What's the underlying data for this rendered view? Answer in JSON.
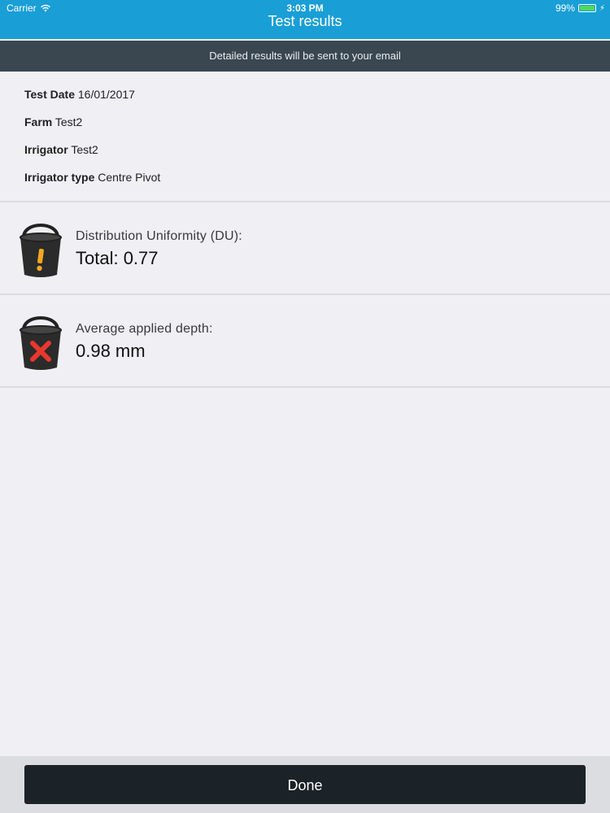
{
  "status_bar": {
    "carrier": "Carrier",
    "time": "3:03 PM",
    "battery_text": "99%",
    "battery_level": 0.99,
    "battery_color": "#4cd964"
  },
  "nav": {
    "title": "Test results",
    "bg_color": "#1a9ed6"
  },
  "banner": {
    "text": "Detailed results will be sent to your email"
  },
  "info": {
    "test_date_label": "Test Date",
    "test_date_value": "16/01/2017",
    "farm_label": "Farm",
    "farm_value": "Test2",
    "irrigator_label": "Irrigator",
    "irrigator_value": "Test2",
    "irrigator_type_label": "Irrigator type",
    "irrigator_type_value": "Centre Pivot"
  },
  "results": [
    {
      "label": "Distribution Uniformity (DU):",
      "value": "Total: 0.77",
      "icon": "bucket-warning-icon",
      "status_color": "#f5a623"
    },
    {
      "label": "Average applied depth:",
      "value": "0.98 mm",
      "icon": "bucket-fail-icon",
      "status_color": "#e8382e"
    }
  ],
  "footer": {
    "done_label": "Done"
  }
}
